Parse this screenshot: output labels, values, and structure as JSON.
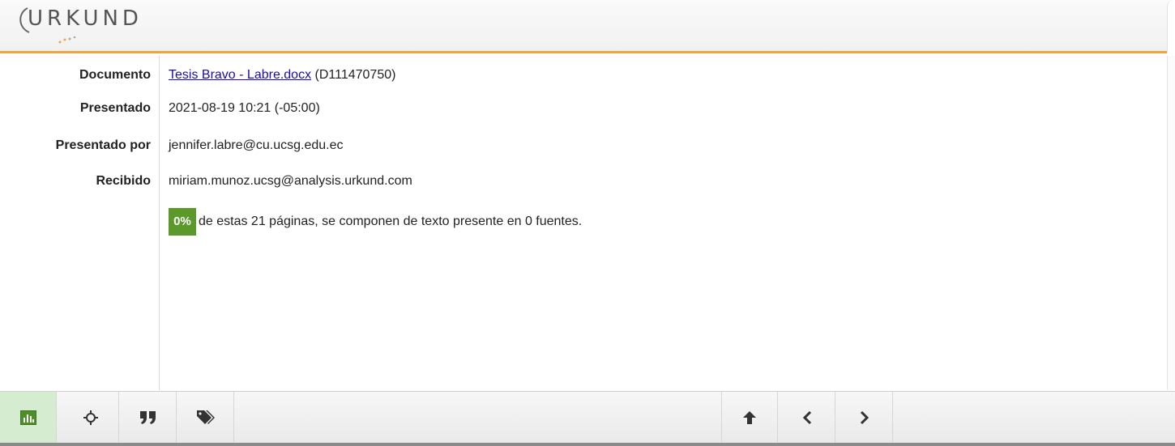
{
  "brand": {
    "logo_text": "URKUND",
    "accent_color": "#f0a440",
    "badge_color": "#5b9a2a",
    "link_color": "#1a0dab"
  },
  "details": {
    "document": {
      "label": "Documento",
      "link_text": "Tesis Bravo - Labre.docx",
      "id_text": "(D111470750)"
    },
    "submitted": {
      "label": "Presentado",
      "value": "2021-08-19 10:21 (-05:00)"
    },
    "submitted_by": {
      "label": "Presentado por",
      "value": "jennifer.labre@cu.ucsg.edu.ec"
    },
    "received": {
      "label": "Recibido",
      "value": "miriam.munoz.ucsg@analysis.urkund.com"
    },
    "summary": {
      "percent": "0%",
      "text": "de estas 21 páginas, se componen de texto presente en 0 fuentes."
    }
  },
  "toolbar": {
    "left_buttons": [
      {
        "icon": "bar-chart-icon",
        "active": true
      },
      {
        "icon": "crosshair-icon",
        "active": false
      },
      {
        "icon": "quote-icon",
        "active": false
      },
      {
        "icon": "tags-icon",
        "active": false
      }
    ],
    "right_buttons": [
      {
        "icon": "arrow-up-icon"
      },
      {
        "icon": "chevron-left-icon"
      },
      {
        "icon": "chevron-right-icon"
      }
    ]
  }
}
